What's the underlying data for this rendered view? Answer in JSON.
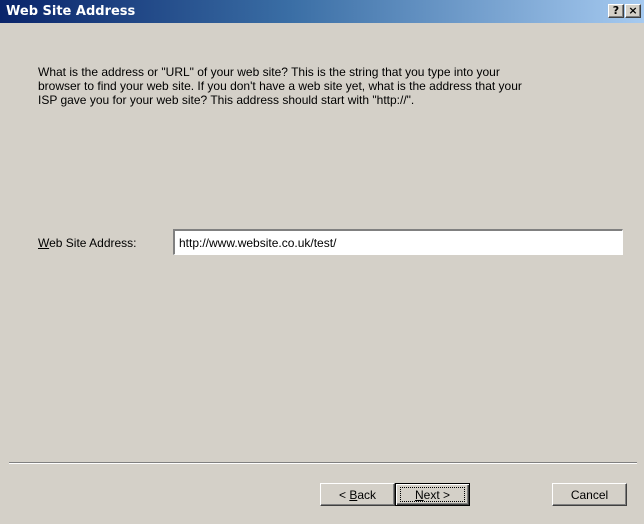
{
  "window": {
    "title": "Web Site Address",
    "help_label": "?",
    "close_label": "×"
  },
  "description": "What is the address or \"URL\" of your web site?  This is the string that you type into your\nbrowser to find your web site.  If you don't have a web site yet, what is the address that your\nISP gave you for your web site?  This address should start with \"http://\".",
  "field": {
    "label_mnemonic": "W",
    "label_rest": "eb Site Address:",
    "value": "http://www.website.co.uk/test/"
  },
  "buttons": {
    "back_prefix": "< ",
    "back_mnemonic": "B",
    "back_rest": "ack",
    "next_mnemonic": "N",
    "next_rest": "ext >",
    "cancel": "Cancel"
  }
}
